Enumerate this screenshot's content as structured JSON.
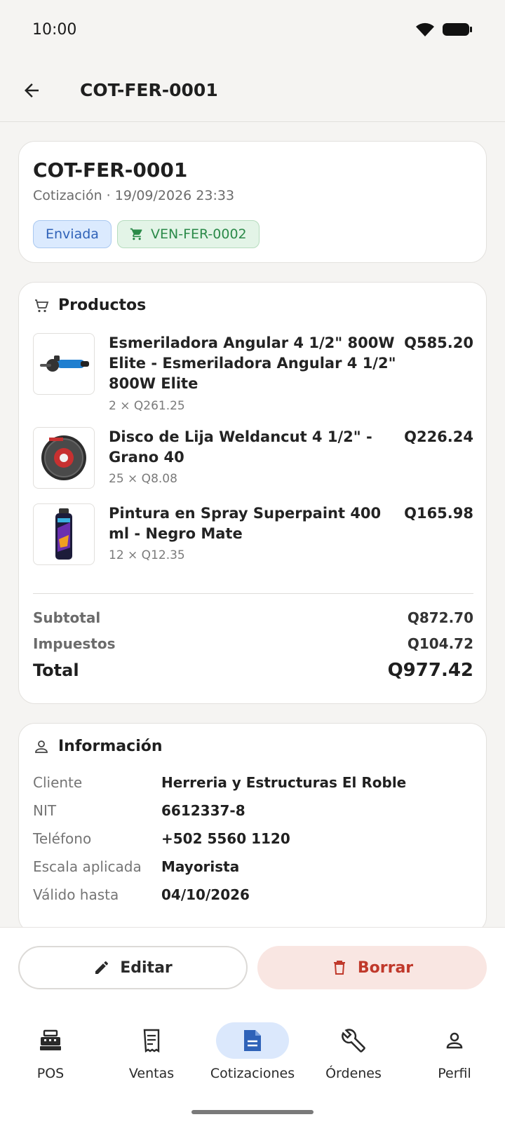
{
  "status_bar": {
    "time": "10:00"
  },
  "app_bar": {
    "title": "COT-FER-0001"
  },
  "quote": {
    "number": "COT-FER-0001",
    "subtitle": "Cotización · 19/09/2026 23:33",
    "status": "Enviada",
    "sale_ref": "VEN-FER-0002"
  },
  "products": {
    "title": "Productos",
    "items": [
      {
        "name": "Esmeriladora Angular 4 1/2\" 800W Elite - Esmeriladora Angular 4 1/2\" 800W Elite",
        "qty": "2 × Q261.25",
        "total": "Q585.20"
      },
      {
        "name": "Disco de Lija Weldancut 4 1/2\" - Grano 40",
        "qty": "25 × Q8.08",
        "total": "Q226.24"
      },
      {
        "name": "Pintura en Spray Superpaint 400 ml - Negro Mate",
        "qty": "12 × Q12.35",
        "total": "Q165.98"
      }
    ],
    "subtotal_label": "Subtotal",
    "subtotal": "Q872.70",
    "tax_label": "Impuestos",
    "tax": "Q104.72",
    "total_label": "Total",
    "total": "Q977.42"
  },
  "info": {
    "title": "Información",
    "rows": [
      {
        "label": "Cliente",
        "value": "Herreria y Estructuras El Roble"
      },
      {
        "label": "NIT",
        "value": "6612337-8"
      },
      {
        "label": "Teléfono",
        "value": "+502 5560 1120"
      },
      {
        "label": "Escala aplicada",
        "value": "Mayorista"
      },
      {
        "label": "Válido hasta",
        "value": "04/10/2026"
      }
    ]
  },
  "actions": {
    "edit": "Editar",
    "delete": "Borrar"
  },
  "nav": {
    "items": [
      {
        "label": "POS",
        "icon": "cash-register-icon"
      },
      {
        "label": "Ventas",
        "icon": "receipt-icon"
      },
      {
        "label": "Cotizaciones",
        "icon": "document-icon"
      },
      {
        "label": "Órdenes",
        "icon": "wrench-icon"
      },
      {
        "label": "Perfil",
        "icon": "person-icon"
      }
    ],
    "active": "Cotizaciones"
  },
  "colors": {
    "accent": "#2f62b8",
    "success": "#2b8a49",
    "danger": "#c0392b",
    "active_nav_bg": "#dbe8fc"
  }
}
